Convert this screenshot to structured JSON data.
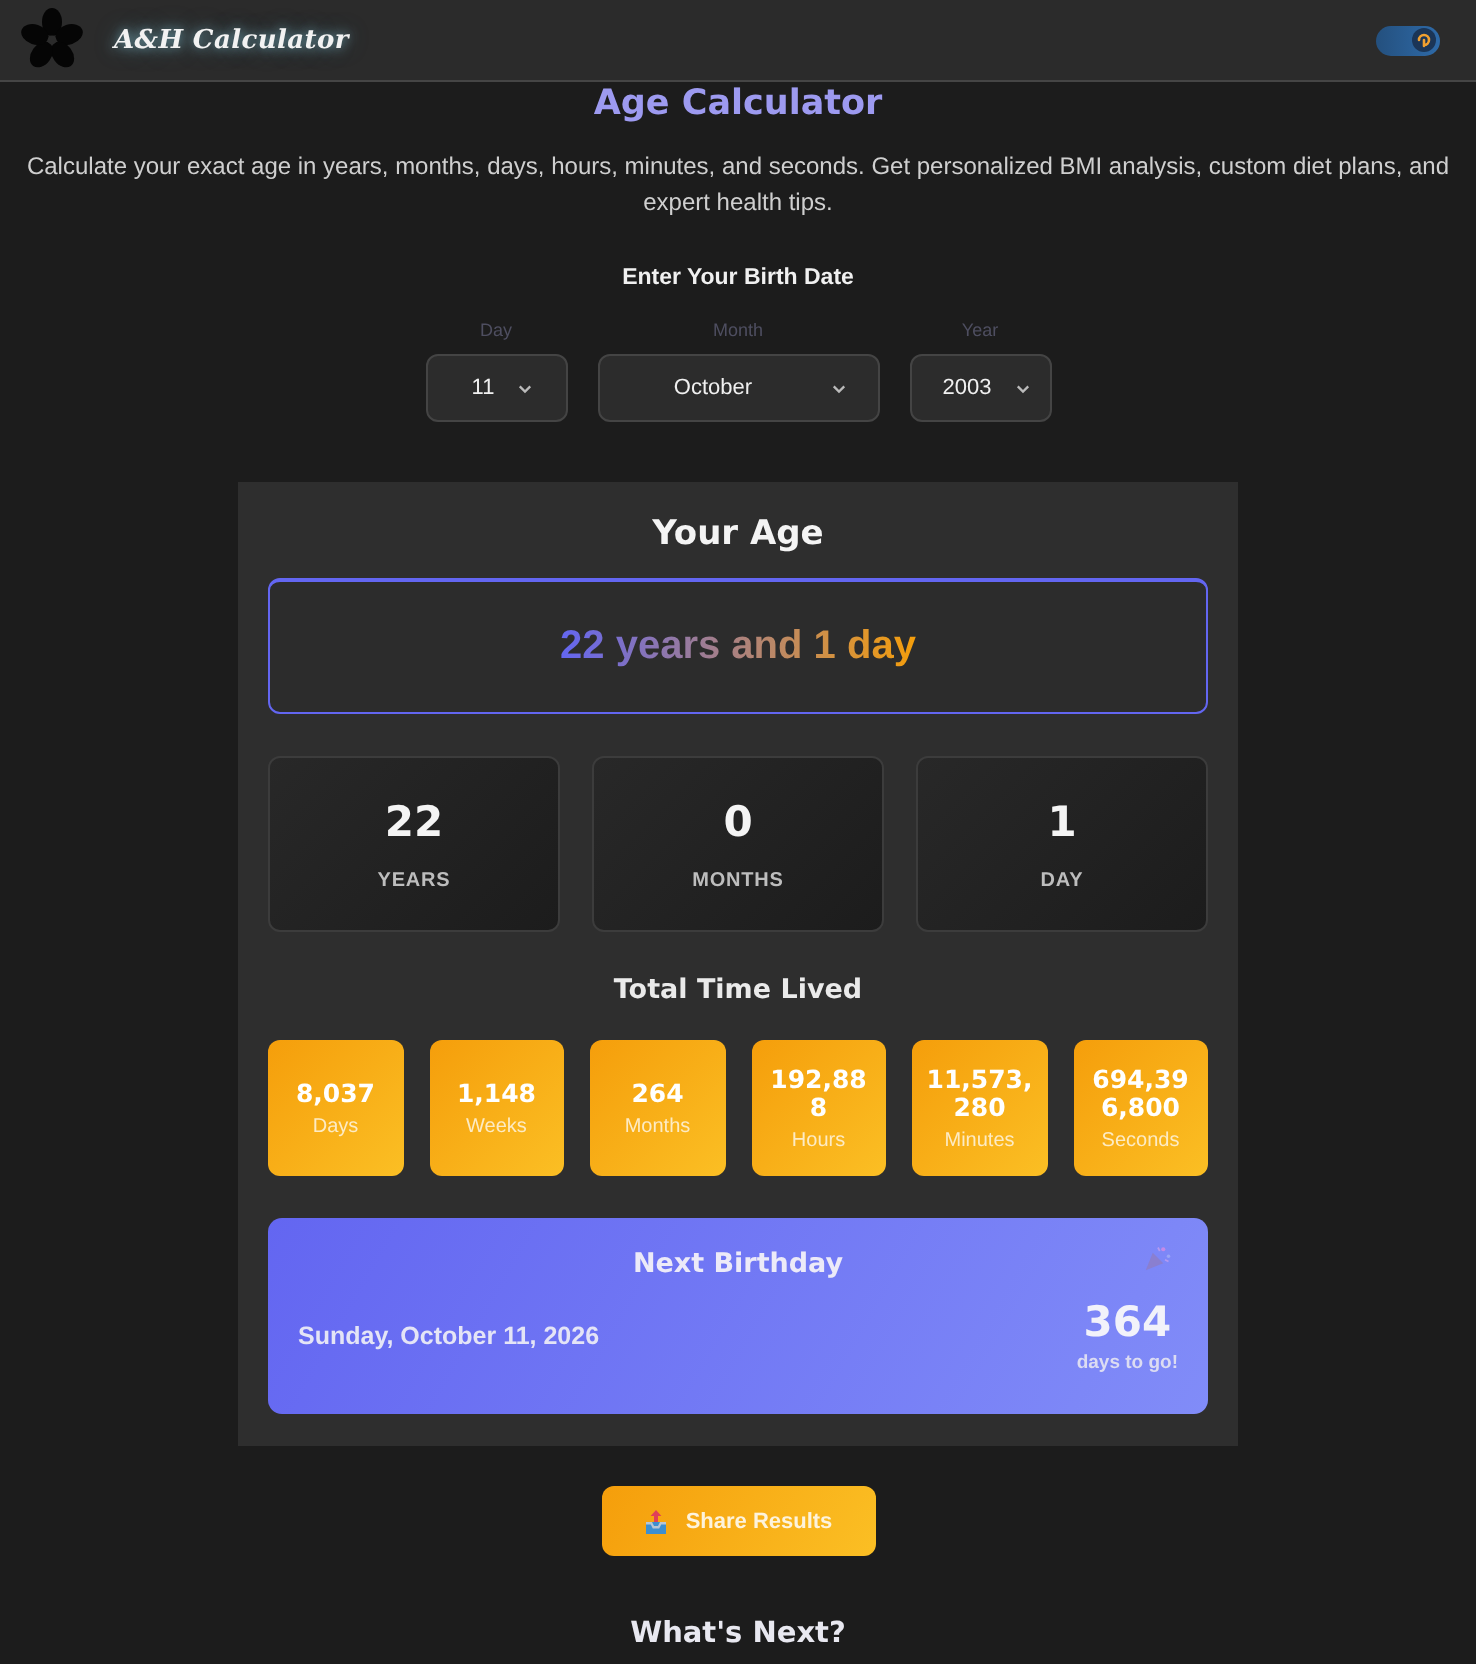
{
  "header": {
    "brand": "A&H Calculator",
    "theme_toggle": {
      "on": true
    }
  },
  "page": {
    "title": "Age Calculator",
    "description": "Calculate your exact age in years, months, days, hours, minutes, and seconds. Get personalized BMI analysis, custom diet plans, and expert health tips."
  },
  "birth_date": {
    "heading": "Enter Your Birth Date",
    "fields": [
      {
        "label": "Day",
        "value": "11"
      },
      {
        "label": "Month",
        "value": "October"
      },
      {
        "label": "Year",
        "value": "2003"
      }
    ]
  },
  "results": {
    "title": "Your Age",
    "summary": "22 years and 1 day",
    "breakdown": [
      {
        "value": "22",
        "unit": "YEARS"
      },
      {
        "value": "0",
        "unit": "MONTHS"
      },
      {
        "value": "1",
        "unit": "DAY"
      }
    ],
    "total_title": "Total Time Lived",
    "totals": [
      {
        "value": "8,037",
        "unit": "Days"
      },
      {
        "value": "1,148",
        "unit": "Weeks"
      },
      {
        "value": "264",
        "unit": "Months"
      },
      {
        "value": "192,888",
        "unit": "Hours"
      },
      {
        "value": "11,573,280",
        "unit": "Minutes"
      },
      {
        "value": "694,396,800",
        "unit": "Seconds"
      }
    ],
    "next_birthday": {
      "title": "Next Birthday",
      "date": "Sunday, October 11, 2026",
      "days": "364",
      "days_caption": "days to go!"
    }
  },
  "share_button": "Share Results",
  "next_heading": "What's Next?"
}
